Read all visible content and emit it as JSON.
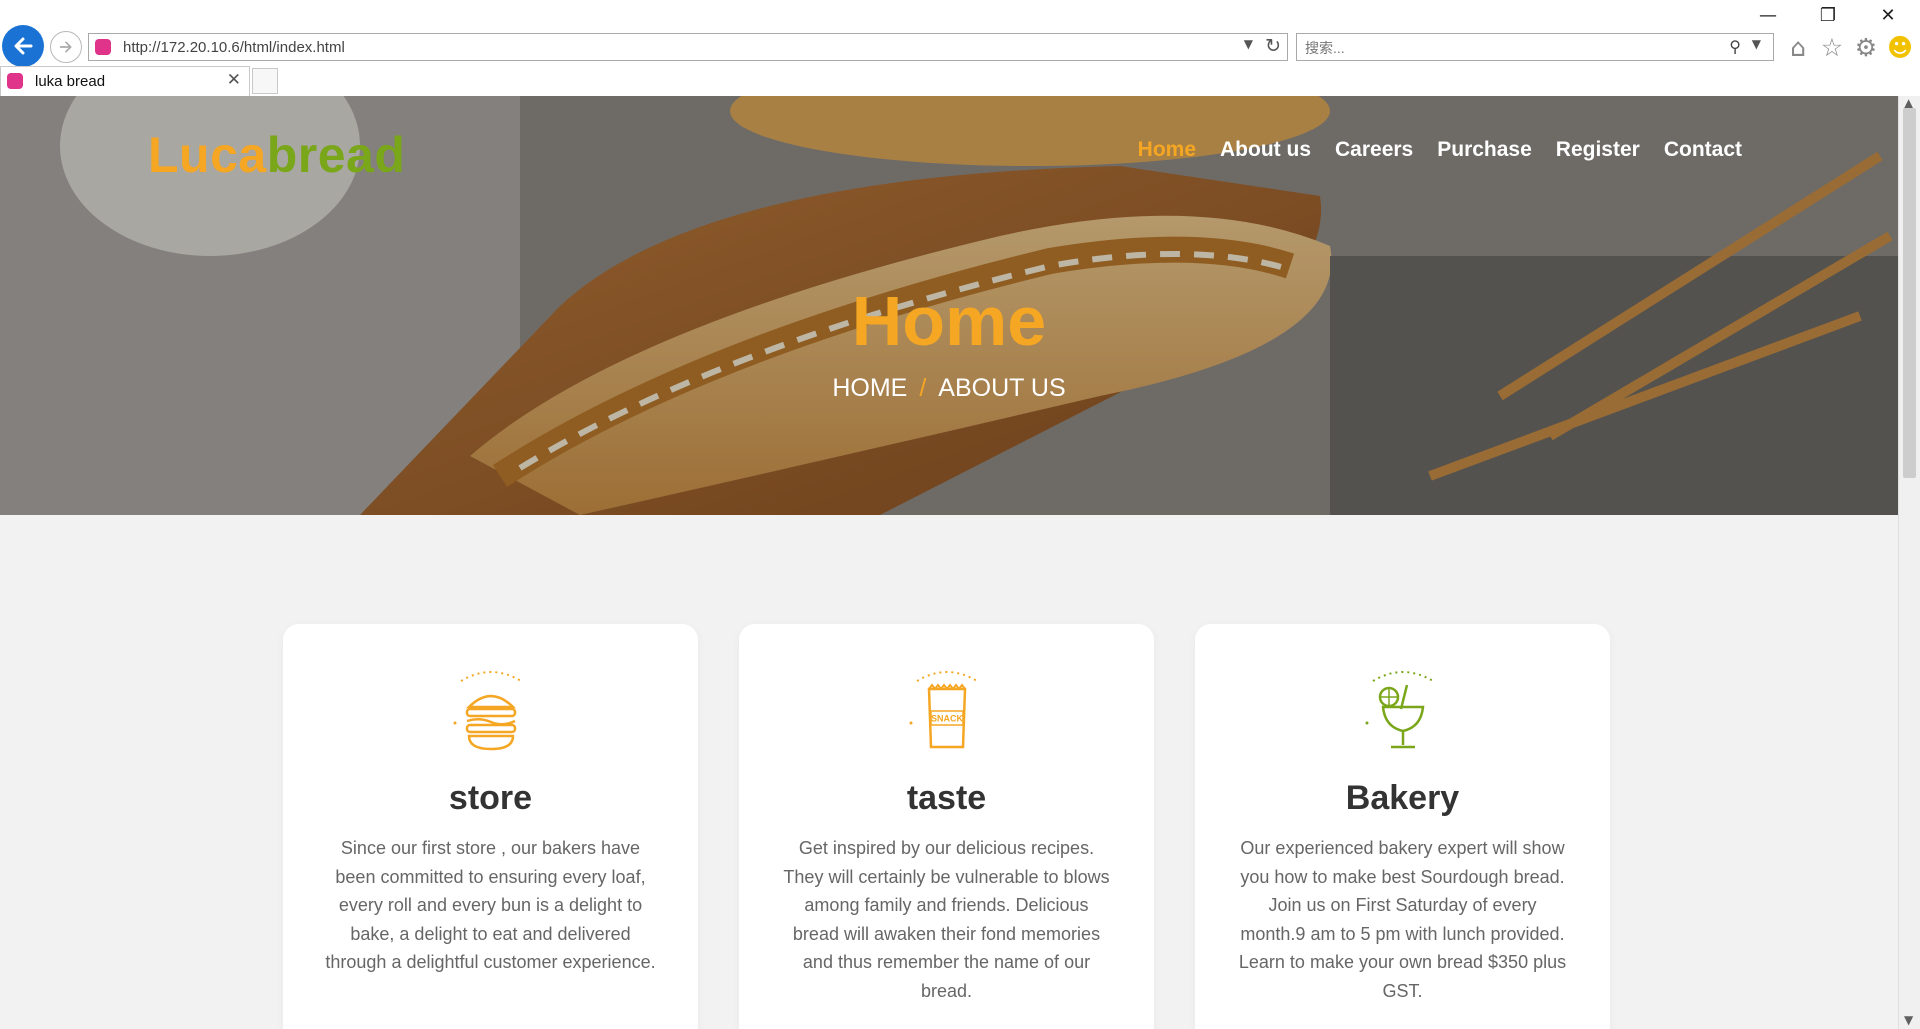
{
  "browser": {
    "url": "http://172.20.10.6/html/index.html",
    "search_placeholder": "搜索...",
    "tab_title": "luka bread",
    "window_controls": [
      "minimize-icon",
      "restore-icon",
      "close-icon"
    ],
    "toolbar_icons": [
      "home-icon",
      "favorites-star-icon",
      "settings-gear-icon",
      "smiley-feedback-icon"
    ]
  },
  "site": {
    "logo_part1": "Luca",
    "logo_part2": "bread",
    "nav": [
      {
        "label": "Home",
        "active": true
      },
      {
        "label": "About us",
        "active": false
      },
      {
        "label": "Careers",
        "active": false
      },
      {
        "label": "Purchase",
        "active": false
      },
      {
        "label": "Register",
        "active": false
      },
      {
        "label": "Contact",
        "active": false
      }
    ],
    "hero_title": "Home",
    "breadcrumb": {
      "home": "HOME",
      "separator": "/",
      "current": "ABOUT US"
    }
  },
  "cards": [
    {
      "icon": "burger-icon",
      "title": "store",
      "text": "Since our first store , our bakers have been committed to ensuring every loaf, every roll and every bun is a delight to bake, a delight to eat and delivered through a delightful customer experience."
    },
    {
      "icon": "snack-bag-icon",
      "title": "taste",
      "text": "Get inspired by our delicious recipes. They will certainly be vulnerable to blows among family and friends. Delicious bread will awaken their fond memories and thus remember the name of our bread."
    },
    {
      "icon": "cocktail-icon",
      "title": "Bakery",
      "text": "Our experienced bakery expert will show you how to make best Sourdough bread. Join us on First Saturday of every month.9 am to 5 pm with lunch provided. Learn to make your own bread $350 plus GST."
    }
  ],
  "snack_icon_text": "SNACK",
  "colors": {
    "accent_orange": "#f5a623",
    "accent_green": "#7aa61a",
    "text_dark": "#333333",
    "text_body": "#666666"
  }
}
